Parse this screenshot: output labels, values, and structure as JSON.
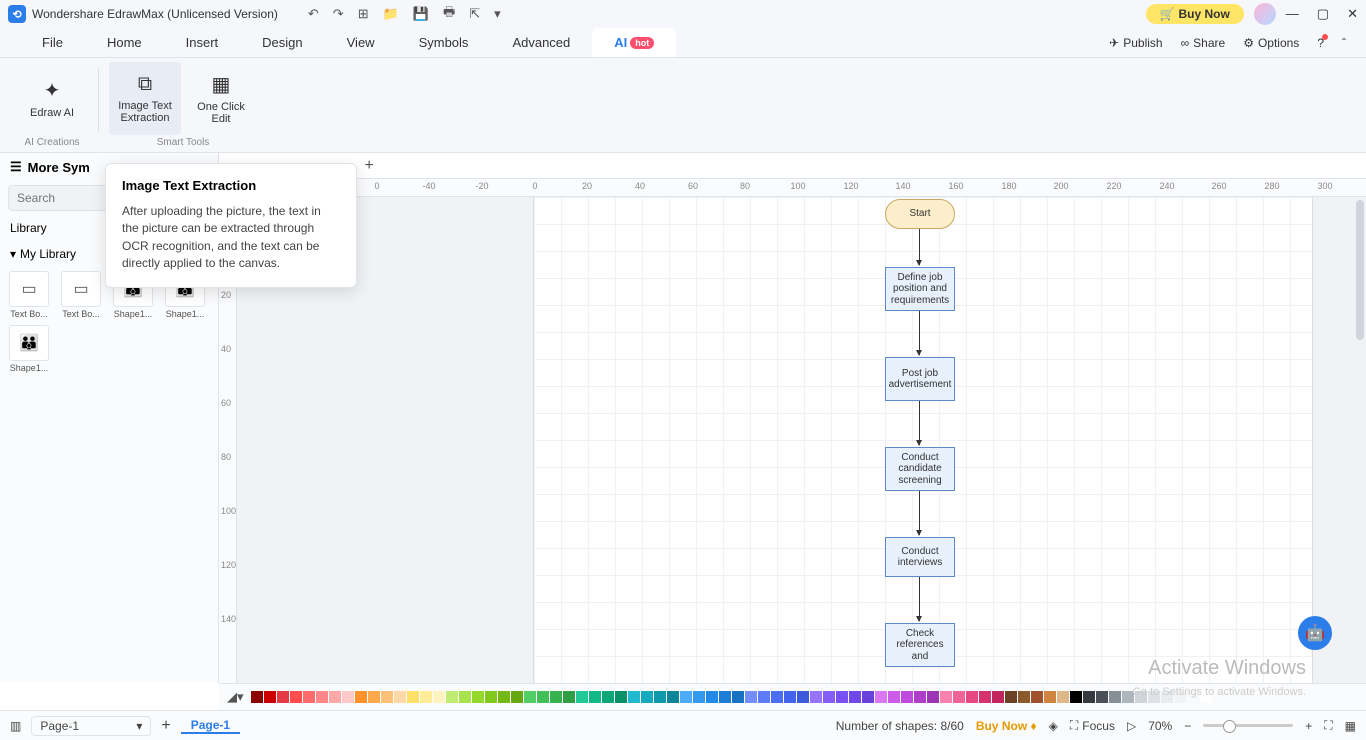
{
  "titlebar": {
    "app_name": "Wondershare EdrawMax (Unlicensed Version)",
    "buy_now": "Buy Now"
  },
  "menu": {
    "tabs": [
      "File",
      "Home",
      "Insert",
      "Design",
      "View",
      "Symbols",
      "Advanced",
      "AI"
    ],
    "hot": "hot",
    "publish": "Publish",
    "share": "Share",
    "options": "Options"
  },
  "ribbon": {
    "edraw_ai": "Edraw AI",
    "image_text": "Image Text Extraction",
    "one_click": "One Click Edit",
    "group1": "AI Creations",
    "group2": "Smart Tools"
  },
  "tooltip": {
    "title": "Image Text Extraction",
    "body": "After uploading the picture, the text in the picture can be extracted through OCR recognition, and the text can be directly applied to the canvas."
  },
  "left": {
    "more_sym": "More Sym",
    "search_ph": "Search",
    "library": "Library",
    "my_library": "My Library",
    "shapes": [
      "Text Bo...",
      "Text Bo...",
      "Shape1...",
      "Shape1...",
      "Shape1..."
    ]
  },
  "ruler_h": [
    "0",
    "-40",
    "-20",
    "0",
    "20",
    "40",
    "60",
    "80",
    "100",
    "120",
    "140",
    "160",
    "180",
    "200",
    "220",
    "240",
    "260",
    "280",
    "300"
  ],
  "ruler_v": [
    "20",
    "40",
    "60",
    "80",
    "100",
    "120",
    "140"
  ],
  "flow": {
    "start": "Start",
    "n1": "Define job position and requirements",
    "n2": "Post job advertisement",
    "n3": "Conduct candidate screening",
    "n4": "Conduct interviews",
    "n5": "Check references and"
  },
  "status": {
    "page_sel": "Page-1",
    "page_tab": "Page-1",
    "shapes": "Number of shapes: 8/60",
    "buy_now": "Buy Now",
    "focus": "Focus",
    "zoom": "70%"
  },
  "watermark": {
    "main": "Activate Windows",
    "sub": "Go to Settings to activate Windows."
  },
  "colors": [
    "#8b0000",
    "#cc0000",
    "#e63946",
    "#ff4d4d",
    "#ff6b6b",
    "#ff8787",
    "#ffa8a8",
    "#ffc9c9",
    "#ff922b",
    "#ffa94d",
    "#ffc078",
    "#ffd8a8",
    "#ffe066",
    "#ffec99",
    "#fff3bf",
    "#c0eb75",
    "#a9e34b",
    "#94d82d",
    "#82c91e",
    "#74b816",
    "#66a80f",
    "#51cf66",
    "#40c057",
    "#37b24d",
    "#2f9e44",
    "#20c997",
    "#12b886",
    "#0ca678",
    "#099268",
    "#22b8cf",
    "#15aabf",
    "#1098ad",
    "#0c8599",
    "#4dabf7",
    "#339af0",
    "#228be6",
    "#1c7ed6",
    "#1971c2",
    "#748ffc",
    "#5c7cfa",
    "#4c6ef5",
    "#4263eb",
    "#3b5bdb",
    "#9775fa",
    "#845ef7",
    "#7950f2",
    "#7048e8",
    "#6741d9",
    "#da77f2",
    "#cc5de8",
    "#be4bdb",
    "#ae3ec9",
    "#9c36b5",
    "#f783ac",
    "#f06595",
    "#e64980",
    "#d6336c",
    "#c2255c",
    "#6b4226",
    "#8b5a2b",
    "#a0522d",
    "#cd853f",
    "#deb887",
    "#000000",
    "#343a40",
    "#495057",
    "#868e96",
    "#adb5bd",
    "#ced4da",
    "#dee2e6",
    "#e9ecef",
    "#f1f3f5",
    "#f8f9fa",
    "#ffffff"
  ]
}
